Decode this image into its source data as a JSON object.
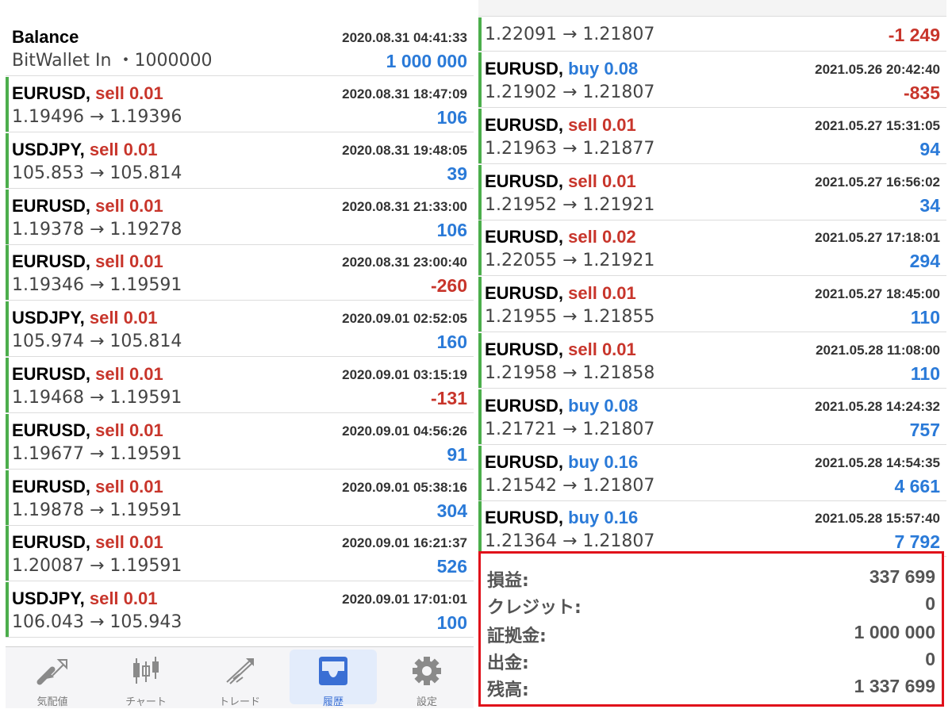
{
  "left_panel": {
    "balance": {
      "title": "Balance",
      "time": "2020.08.31 04:41:33",
      "desc": "BitWallet In ・1000000",
      "amount": "1 000 000"
    },
    "trades": [
      {
        "symbol": "EURUSD,",
        "side": "sell 0.01",
        "dir": "sell",
        "time": "2020.08.31 18:47:09",
        "prices": "1.19496 → 1.19396",
        "pnl": "106",
        "pnl_sign": "pos"
      },
      {
        "symbol": "USDJPY,",
        "side": "sell 0.01",
        "dir": "sell",
        "time": "2020.08.31 19:48:05",
        "prices": "105.853 → 105.814",
        "pnl": "39",
        "pnl_sign": "pos"
      },
      {
        "symbol": "EURUSD,",
        "side": "sell 0.01",
        "dir": "sell",
        "time": "2020.08.31 21:33:00",
        "prices": "1.19378 → 1.19278",
        "pnl": "106",
        "pnl_sign": "pos"
      },
      {
        "symbol": "EURUSD,",
        "side": "sell 0.01",
        "dir": "sell",
        "time": "2020.08.31 23:00:40",
        "prices": "1.19346 → 1.19591",
        "pnl": "-260",
        "pnl_sign": "neg"
      },
      {
        "symbol": "USDJPY,",
        "side": "sell 0.01",
        "dir": "sell",
        "time": "2020.09.01 02:52:05",
        "prices": "105.974 → 105.814",
        "pnl": "160",
        "pnl_sign": "pos"
      },
      {
        "symbol": "EURUSD,",
        "side": "sell 0.01",
        "dir": "sell",
        "time": "2020.09.01 03:15:19",
        "prices": "1.19468 → 1.19591",
        "pnl": "-131",
        "pnl_sign": "neg"
      },
      {
        "symbol": "EURUSD,",
        "side": "sell 0.01",
        "dir": "sell",
        "time": "2020.09.01 04:56:26",
        "prices": "1.19677 → 1.19591",
        "pnl": "91",
        "pnl_sign": "pos"
      },
      {
        "symbol": "EURUSD,",
        "side": "sell 0.01",
        "dir": "sell",
        "time": "2020.09.01 05:38:16",
        "prices": "1.19878 → 1.19591",
        "pnl": "304",
        "pnl_sign": "pos"
      },
      {
        "symbol": "EURUSD,",
        "side": "sell 0.01",
        "dir": "sell",
        "time": "2020.09.01 16:21:37",
        "prices": "1.20087 → 1.19591",
        "pnl": "526",
        "pnl_sign": "pos"
      },
      {
        "symbol": "USDJPY,",
        "side": "sell 0.01",
        "dir": "sell",
        "time": "2020.09.01 17:01:01",
        "prices": "106.043 → 105.943",
        "pnl": "100",
        "pnl_sign": "pos"
      }
    ]
  },
  "right_panel": {
    "partial_top": {
      "prices": "1.22091 → 1.21807",
      "pnl": "-1 249",
      "pnl_sign": "neg"
    },
    "trades": [
      {
        "symbol": "EURUSD,",
        "side": "buy 0.08",
        "dir": "buy",
        "time": "2021.05.26 20:42:40",
        "prices": "1.21902 → 1.21807",
        "pnl": "-835",
        "pnl_sign": "neg"
      },
      {
        "symbol": "EURUSD,",
        "side": "sell 0.01",
        "dir": "sell",
        "time": "2021.05.27 15:31:05",
        "prices": "1.21963 → 1.21877",
        "pnl": "94",
        "pnl_sign": "pos"
      },
      {
        "symbol": "EURUSD,",
        "side": "sell 0.01",
        "dir": "sell",
        "time": "2021.05.27 16:56:02",
        "prices": "1.21952 → 1.21921",
        "pnl": "34",
        "pnl_sign": "pos"
      },
      {
        "symbol": "EURUSD,",
        "side": "sell 0.02",
        "dir": "sell",
        "time": "2021.05.27 17:18:01",
        "prices": "1.22055 → 1.21921",
        "pnl": "294",
        "pnl_sign": "pos"
      },
      {
        "symbol": "EURUSD,",
        "side": "sell 0.01",
        "dir": "sell",
        "time": "2021.05.27 18:45:00",
        "prices": "1.21955 → 1.21855",
        "pnl": "110",
        "pnl_sign": "pos"
      },
      {
        "symbol": "EURUSD,",
        "side": "sell 0.01",
        "dir": "sell",
        "time": "2021.05.28 11:08:00",
        "prices": "1.21958 → 1.21858",
        "pnl": "110",
        "pnl_sign": "pos"
      },
      {
        "symbol": "EURUSD,",
        "side": "buy 0.08",
        "dir": "buy",
        "time": "2021.05.28 14:24:32",
        "prices": "1.21721 → 1.21807",
        "pnl": "757",
        "pnl_sign": "pos"
      },
      {
        "symbol": "EURUSD,",
        "side": "buy 0.16",
        "dir": "buy",
        "time": "2021.05.28 14:54:35",
        "prices": "1.21542 → 1.21807",
        "pnl": "4 661",
        "pnl_sign": "pos"
      },
      {
        "symbol": "EURUSD,",
        "side": "buy 0.16",
        "dir": "buy",
        "time": "2021.05.28 15:57:40",
        "prices": "1.21364 → 1.21807",
        "pnl": "7 792",
        "pnl_sign": "pos"
      }
    ]
  },
  "summary": [
    {
      "label": "損益:",
      "value": "337 699"
    },
    {
      "label": "クレジット:",
      "value": "0"
    },
    {
      "label": "証拠金:",
      "value": "1 000 000"
    },
    {
      "label": "出金:",
      "value": "0"
    },
    {
      "label": "残高:",
      "value": "1 337 699"
    }
  ],
  "tabbar": [
    {
      "label": "気配値",
      "icon": "quotes-icon",
      "active": false
    },
    {
      "label": "チャート",
      "icon": "chart-icon",
      "active": false
    },
    {
      "label": "トレード",
      "icon": "trade-icon",
      "active": false
    },
    {
      "label": "履歴",
      "icon": "history-icon",
      "active": true
    },
    {
      "label": "設定",
      "icon": "settings-icon",
      "active": false
    }
  ],
  "colors": {
    "sell": "#c8352b",
    "buy": "#2a7ad8",
    "profit": "#2a7ad8",
    "loss": "#c8352b",
    "trade_bar": "#4cae4c",
    "highlight_border": "#e0101a",
    "active_tab": "#3a6fd4"
  }
}
